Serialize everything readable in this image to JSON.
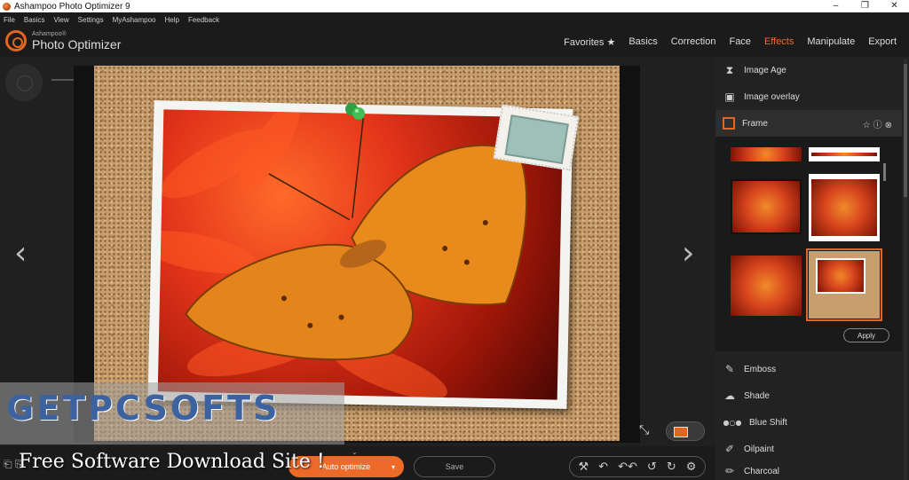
{
  "window": {
    "title": "Ashampoo Photo Optimizer 9",
    "minimize": "–",
    "maximize": "❐",
    "close": "✕"
  },
  "menu": [
    "File",
    "Basics",
    "View",
    "Settings",
    "MyAshampoo",
    "Help",
    "Feedback"
  ],
  "logo": {
    "brand": "Ashampoo®",
    "product": "Photo Optimizer"
  },
  "tabs": [
    {
      "label": "Favorites ★",
      "active": false
    },
    {
      "label": "Basics",
      "active": false
    },
    {
      "label": "Correction",
      "active": false
    },
    {
      "label": "Face",
      "active": false
    },
    {
      "label": "Effects",
      "active": true
    },
    {
      "label": "Manipulate",
      "active": false
    },
    {
      "label": "Export",
      "active": false
    }
  ],
  "accent_color": "#ee6a28",
  "canvas": {
    "prev_arrow": "‹",
    "next_arrow": "›",
    "compare_icon": "⤡"
  },
  "effects_top": [
    {
      "label": "Image Age",
      "icon": "hourglass-icon",
      "glyph": "⧗"
    },
    {
      "label": "Image overlay",
      "icon": "overlay-icon",
      "glyph": "▣"
    },
    {
      "label": "Frame",
      "icon": "frame-icon",
      "glyph": "",
      "selected": true,
      "actions": "☆ⓘ⊗"
    }
  ],
  "frame_panel": {
    "apply_label": "Apply"
  },
  "effects_bottom": [
    {
      "label": "Emboss",
      "icon": "emboss-icon",
      "glyph": "✎"
    },
    {
      "label": "Shade",
      "icon": "shade-icon",
      "glyph": "☁"
    },
    {
      "label": "Blue Shift",
      "icon": "blue-shift-icon",
      "glyph": "●○●"
    },
    {
      "label": "Oilpaint",
      "icon": "oilpaint-icon",
      "glyph": "✐"
    },
    {
      "label": "Charcoal",
      "icon": "charcoal-icon",
      "glyph": "✏"
    }
  ],
  "bottom": {
    "auto_optimize": "Auto optimize",
    "auto_caret": "▾",
    "save": "Save",
    "collapse": "⌄",
    "tools": [
      "⚒",
      "↶",
      "↶↶",
      "↺",
      "↻",
      "⚙"
    ]
  },
  "watermark": {
    "title": "GETPCSOFTS",
    "subtitle": "Free Software Download Site !",
    "icons": "⎗ ⎘"
  }
}
